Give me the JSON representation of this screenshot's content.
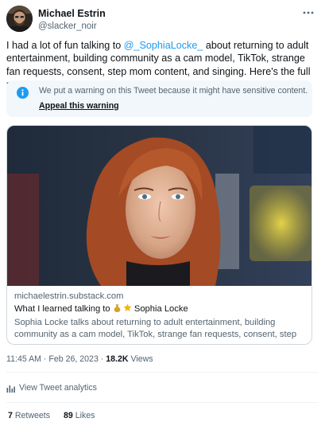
{
  "tweet": {
    "author": {
      "display_name": "Michael Estrin",
      "handle": "@slacker_noir",
      "avatar_icon": "author-avatar-photo"
    },
    "text_before": "I had a lot of fun talking to ",
    "mention": "@_SophiaLocke_",
    "text_after": " about returning to adult entertainment, building community as a cam model, TikTok, strange fan requests, consent, step mom content, and singing. Here's the full story!",
    "warning": {
      "message": "We put a warning on this Tweet because it might have sensitive content.",
      "link": "Appeal this warning"
    },
    "card": {
      "domain": "michaelestrin.substack.com",
      "title_before": "What I learned talking to ",
      "title_after": " Sophia Locke",
      "description": "Sophia Locke talks about returning to adult entertainment, building community as a cam model, TikTok, strange fan requests, consent, step mo..."
    },
    "time": "11:45 AM",
    "separator": " · ",
    "date": "Feb 26, 2023",
    "views_count": "18.2K",
    "views_label": " Views",
    "analytics_label": "View Tweet analytics",
    "retweets_count": "7",
    "retweets_label": " Retweets",
    "likes_count": "89",
    "likes_label": " Likes"
  },
  "colors": {
    "accent": "#1d9bf0",
    "text": "#0f1419",
    "muted": "#536471",
    "warning_bg": "#f2f7fb",
    "border": "#cfd9de"
  }
}
